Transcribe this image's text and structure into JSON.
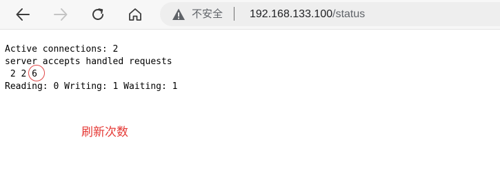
{
  "browser": {
    "back_icon": "arrow-left-icon",
    "forward_icon": "arrow-right-icon",
    "reload_icon": "reload-icon",
    "home_icon": "home-icon",
    "security_icon": "warning-triangle-icon",
    "security_label": "不安全",
    "url_host": "192.168.133.100",
    "url_path": "/status"
  },
  "status_page": {
    "active_connections": "Active connections: 2",
    "header_line": "server accepts handled requests",
    "counts_prefix": " 2 2 ",
    "requests_value": "6",
    "rw_line": "Reading: 0 Writing: 1 Waiting: 1"
  },
  "annotation": {
    "text": "刷新次数",
    "color": "#e53935"
  }
}
